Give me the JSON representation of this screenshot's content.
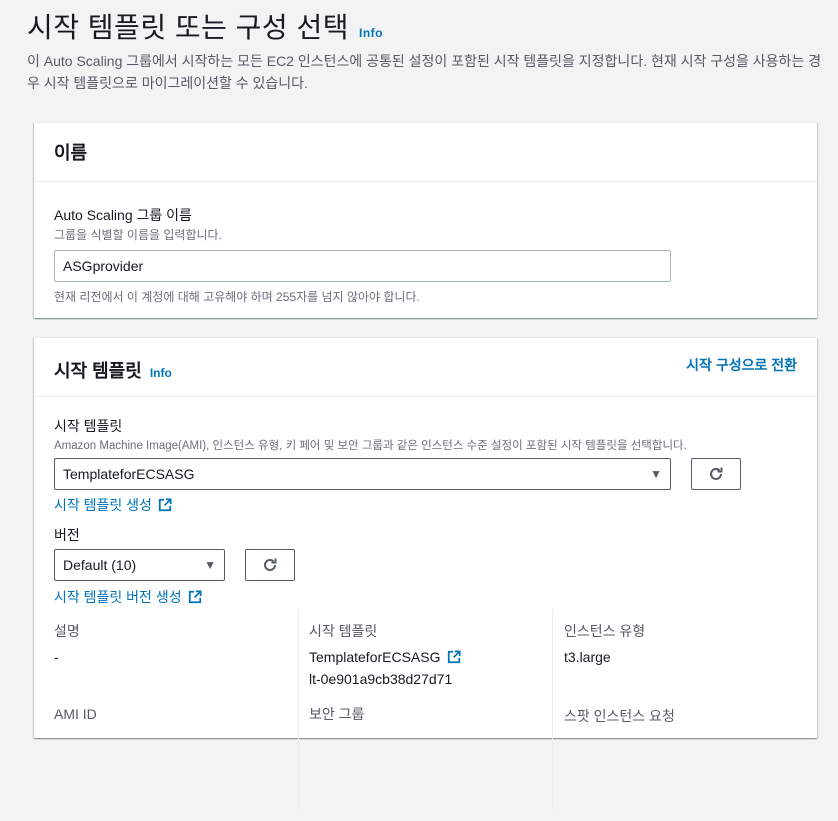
{
  "header": {
    "title": "시작 템플릿 또는 구성 선택",
    "info": "Info",
    "description": "이 Auto Scaling 그룹에서 시작하는 모든 EC2 인스턴스에 공통된 설정이 포함된 시작 템플릿을 지정합니다. 현재 시작 구성을 사용하는 경우 시작 템플릿으로 마이그레이션할 수 있습니다."
  },
  "name_panel": {
    "title": "이름",
    "label": "Auto Scaling 그룹 이름",
    "description": "그룹을 식별할 이름을 입력합니다.",
    "value": "ASGprovider",
    "constraint": "현재 리전에서 이 계정에 대해 고유해야 하며 255자를 넘지 않아야 합니다."
  },
  "template_panel": {
    "title": "시작 템플릿",
    "info": "Info",
    "switch_action": "시작 구성으로 전환",
    "label": "시작 템플릿",
    "description": "Amazon Machine Image(AMI), 인스턴스 유형, 키 페어 및 보안 그룹과 같은 인스턴스 수준 설정이 포함된 시작 템플릿을 선택합니다.",
    "selected": "TemplateforECSASG",
    "create_link": "시작 템플릿 생성",
    "version_label": "버전",
    "version_selected": "Default (10)",
    "create_version_link": "시작 템플릿 버전 생성",
    "details": {
      "col1": {
        "label1": "설명",
        "value1": "-",
        "label2": "AMI ID"
      },
      "col2": {
        "label1": "시작 템플릿",
        "link": "TemplateforECSASG",
        "id": "lt-0e901a9cb38d27d71",
        "label2": "보안 그룹"
      },
      "col3": {
        "label1": "인스턴스 유형",
        "value1": "t3.large",
        "label2": "스팟 인스턴스 요청"
      }
    }
  },
  "colors": {
    "link": "#0073bb",
    "text": "#16191f",
    "muted": "#687078",
    "background": "#f2f3f3"
  },
  "icons": [
    "external-link-icon",
    "refresh-icon",
    "caret-down-icon"
  ]
}
